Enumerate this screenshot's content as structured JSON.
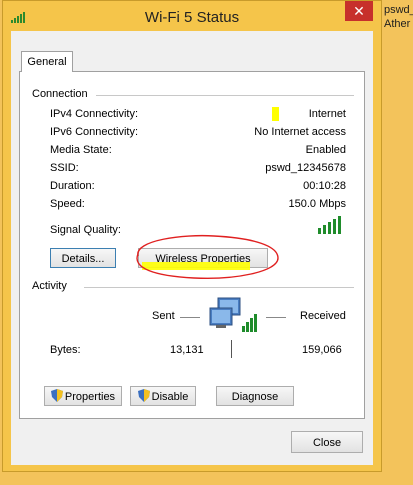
{
  "background": {
    "left_item": "pswd_12345678",
    "right_item_line1": "pswd_",
    "right_item_line2": "Ather"
  },
  "window": {
    "title": "Wi-Fi 5 Status",
    "close_glyph": "✕",
    "tab": "General"
  },
  "connection": {
    "group_title": "Connection",
    "rows": [
      {
        "label": "IPv4 Connectivity:",
        "value": "Internet"
      },
      {
        "label": "IPv6 Connectivity:",
        "value": "No Internet access"
      },
      {
        "label": "Media State:",
        "value": "Enabled"
      },
      {
        "label": "SSID:",
        "value": "pswd_12345678"
      },
      {
        "label": "Duration:",
        "value": "00:10:28"
      },
      {
        "label": "Speed:",
        "value": "150.0 Mbps"
      }
    ],
    "signal_label": "Signal Quality:",
    "signal_bars": 5,
    "details_button": "Details...",
    "wireless_button": "Wireless Properties"
  },
  "activity": {
    "group_title": "Activity",
    "sent_label": "Sent",
    "received_label": "Received",
    "bytes_label": "Bytes:",
    "bytes_sent": "13,131",
    "bytes_received": "159,066"
  },
  "buttons": {
    "properties": "Properties",
    "disable": "Disable",
    "diagnose": "Diagnose",
    "close": "Close"
  },
  "colors": {
    "accent_yellow": "#ffff00",
    "annotation_red": "#e02020",
    "signal_green": "#1f8c2b"
  }
}
